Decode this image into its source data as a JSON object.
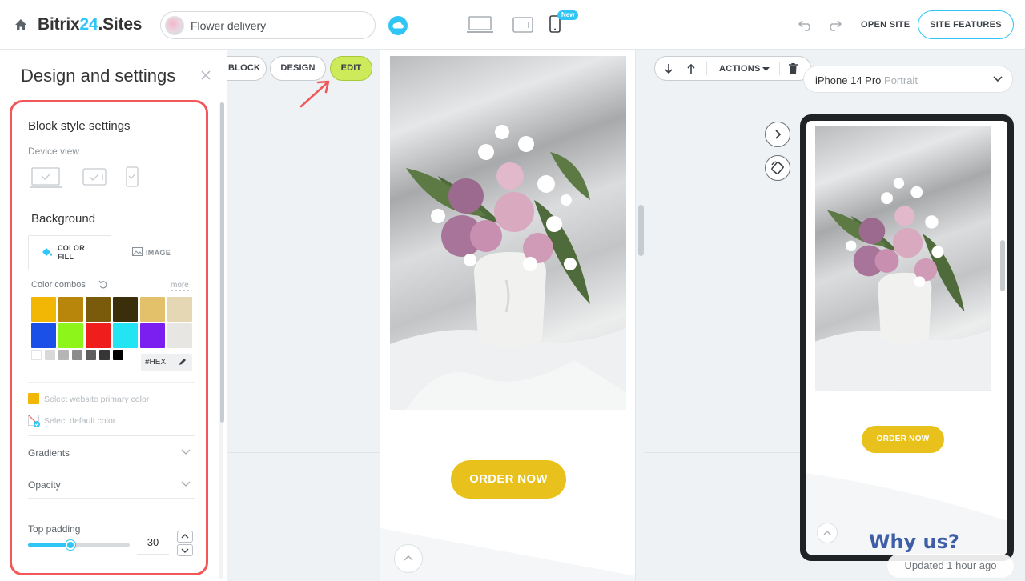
{
  "header": {
    "logo_prefix": "Bitrix",
    "logo_num": "24",
    "logo_suffix": ".Sites",
    "site_name": "Flower delivery",
    "new_badge": "New",
    "open_site": "OPEN SITE",
    "site_features": "SITE FEATURES"
  },
  "panel": {
    "title": "Design and settings",
    "block_style_title": "Block style settings",
    "device_view_label": "Device view",
    "background_title": "Background",
    "tab_color_fill": "COLOR FILL",
    "tab_image": "IMAGE",
    "color_combos_label": "Color combos",
    "more_link": "more",
    "hex_label": "#HEX",
    "select_primary": "Select website primary color",
    "select_default": "Select default color",
    "gradients": "Gradients",
    "opacity": "Opacity",
    "top_padding_label": "Top padding",
    "top_padding_value": "30",
    "top_padding_fraction": 0.42,
    "swatch_colors_row1": [
      "#f2b705",
      "#b8860b",
      "#7a5a0b",
      "#3b2e0a",
      "#e3c16b",
      "#e6d7b4"
    ],
    "swatch_colors_row2": [
      "#1a4fe8",
      "#8ef51a",
      "#f01d1d",
      "#23e4f3",
      "#7b1ff0",
      "#e8e6e3"
    ],
    "gray_colors": [
      "#ffffff",
      "#d9d9d9",
      "#b5b5b5",
      "#8c8c8c",
      "#5e5e5e",
      "#363636",
      "#000000"
    ]
  },
  "editor": {
    "block_btn": "BLOCK",
    "design_btn": "DESIGN",
    "edit_btn": "EDIT",
    "order_now": "ORDER NOW",
    "actions": "ACTIONS"
  },
  "preview": {
    "device_name": "iPhone 14 Pro",
    "orientation": "Portrait",
    "order_now": "ORDER NOW",
    "why_us": "Why us?",
    "updated": "Updated 1 hour ago"
  },
  "colors": {
    "accent": "#2fc6f6",
    "edit_green": "#cdea5a",
    "order_yellow": "#e8c11c",
    "highlight_red": "#f2585a"
  }
}
